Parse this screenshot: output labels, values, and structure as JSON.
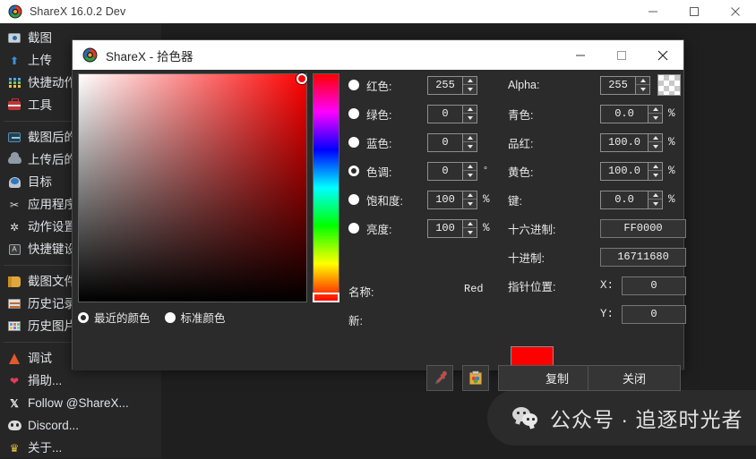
{
  "main_window": {
    "title": "ShareX 16.0.2 Dev",
    "icon": "sharex-logo-icon",
    "controls": {
      "minimize": "minimize-icon",
      "maximize": "maximize-icon",
      "close": "close-icon"
    }
  },
  "sidebar": {
    "groups": [
      {
        "items": [
          {
            "label": "截图",
            "icon": "camera-icon"
          },
          {
            "label": "上传",
            "icon": "upload-arrow-icon"
          },
          {
            "label": "快捷动作",
            "icon": "grid-icon"
          },
          {
            "label": "工具",
            "icon": "toolbox-icon"
          }
        ]
      },
      {
        "items": [
          {
            "label": "截图后的任务",
            "icon": "after-capture-icon"
          },
          {
            "label": "上传后的任务",
            "icon": "cloud-icon"
          },
          {
            "label": "目标",
            "icon": "destination-icon"
          },
          {
            "label": "应用程序设置",
            "icon": "application-settings-icon"
          },
          {
            "label": "动作设置",
            "icon": "gear-icon"
          },
          {
            "label": "快捷键设置",
            "icon": "hotkey-icon"
          }
        ]
      },
      {
        "items": [
          {
            "label": "截图文件夹",
            "icon": "folder-icon"
          },
          {
            "label": "历史记录",
            "icon": "history-icon"
          },
          {
            "label": "历史图片",
            "icon": "image-history-icon"
          }
        ]
      },
      {
        "items": [
          {
            "label": "调试",
            "icon": "debug-cone-icon"
          },
          {
            "label": "捐助...",
            "icon": "heart-icon"
          },
          {
            "label": "Follow @ShareX...",
            "icon": "x-twitter-icon"
          },
          {
            "label": "Discord...",
            "icon": "discord-icon"
          },
          {
            "label": "关于...",
            "icon": "crown-icon"
          }
        ]
      }
    ]
  },
  "watermark": {
    "icon": "wechat-icon",
    "text": "公众号 · 追逐时光者"
  },
  "picker_dialog": {
    "title": "ShareX - 拾色器",
    "icon": "sharex-logo-icon",
    "controls": {
      "minimize": "minimize-icon",
      "maximize": "maximize-icon",
      "close": "close-icon"
    },
    "palette_mode": {
      "options": [
        {
          "label": "最近的颜色",
          "selected": true
        },
        {
          "label": "标准颜色",
          "selected": false
        }
      ]
    },
    "left_fields": [
      {
        "name": "red",
        "label": "红色:",
        "value": "255",
        "unit": "",
        "radio_selected": false
      },
      {
        "name": "green",
        "label": "绿色:",
        "value": "0",
        "unit": "",
        "radio_selected": false
      },
      {
        "name": "blue",
        "label": "蓝色:",
        "value": "0",
        "unit": "",
        "radio_selected": false
      },
      {
        "name": "hue",
        "label": "色调:",
        "value": "0",
        "unit": "°",
        "radio_selected": true
      },
      {
        "name": "saturation",
        "label": "饱和度:",
        "value": "100",
        "unit": "%",
        "radio_selected": false
      },
      {
        "name": "brightness",
        "label": "亮度:",
        "value": "100",
        "unit": "%",
        "radio_selected": false
      }
    ],
    "right_fields": [
      {
        "name": "alpha",
        "label": "Alpha:",
        "value": "255",
        "unit": ""
      },
      {
        "name": "cyan",
        "label": "青色:",
        "value": "0.0",
        "unit": "%"
      },
      {
        "name": "magenta",
        "label": "品红:",
        "value": "100.0",
        "unit": "%"
      },
      {
        "name": "yellow",
        "label": "黄色:",
        "value": "100.0",
        "unit": "%"
      },
      {
        "name": "key",
        "label": "键:",
        "value": "0.0",
        "unit": "%"
      }
    ],
    "hex": {
      "label": "十六进制:",
      "value": "FF0000"
    },
    "decimal": {
      "label": "十进制:",
      "value": "16711680"
    },
    "cursor_position": {
      "label": "指针位置:",
      "x_label": "X:",
      "x_value": "0",
      "y_label": "Y:",
      "y_value": "0"
    },
    "color_name": {
      "label": "名称:",
      "value": "Red"
    },
    "new_color": {
      "label": "新:",
      "value": "#FF0000"
    },
    "buttons": {
      "eyedropper": "eyedropper-icon",
      "clipboard": "clipboard-icon",
      "copy": "复制",
      "close": "关闭"
    },
    "colors": {
      "selected": "#FF0000",
      "hue_top": "#FF0000",
      "alpha_swatch": "#FFFFFF"
    }
  }
}
